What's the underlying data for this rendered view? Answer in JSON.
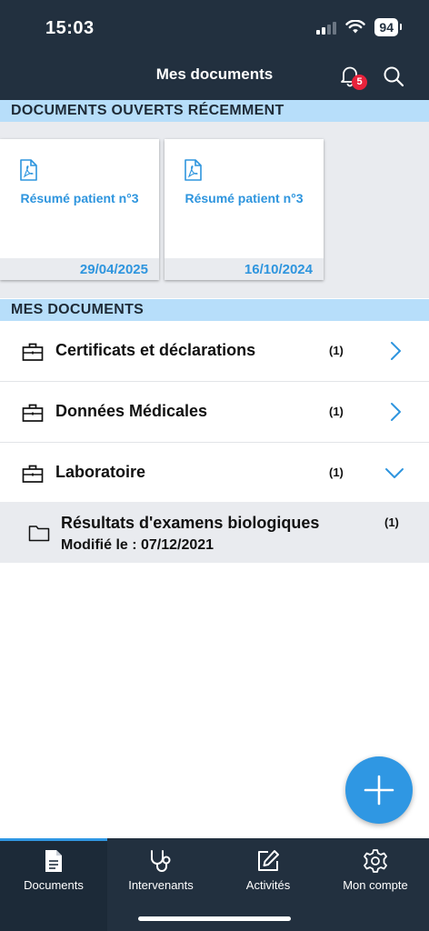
{
  "status_bar": {
    "time": "15:03",
    "battery": "94"
  },
  "header": {
    "title": "Mes documents",
    "notification_count": "5"
  },
  "recent": {
    "section_title": "DOCUMENTS OUVERTS RÉCEMMENT",
    "cards": [
      {
        "title": "Résumé patient n°3",
        "date": "29/04/2025"
      },
      {
        "title": "Résumé patient n°3",
        "date": "16/10/2024"
      }
    ]
  },
  "documents": {
    "section_title": "MES DOCUMENTS",
    "folders": [
      {
        "label": "Certificats et déclarations",
        "count": "(1)"
      },
      {
        "label": "Données Médicales",
        "count": "(1)"
      },
      {
        "label": "Laboratoire",
        "count": "(1)"
      }
    ],
    "subfolder": {
      "label": "Résultats d'examens biologiques",
      "modified": "Modifié le : 07/12/2021",
      "count": "(1)"
    }
  },
  "tabs": [
    {
      "label": "Documents"
    },
    {
      "label": "Intervenants"
    },
    {
      "label": "Activités"
    },
    {
      "label": "Mon compte"
    }
  ],
  "colors": {
    "navy": "#22303f",
    "accent": "#2f97e3",
    "section_bg": "#b7defa",
    "badge": "#e8223b"
  }
}
